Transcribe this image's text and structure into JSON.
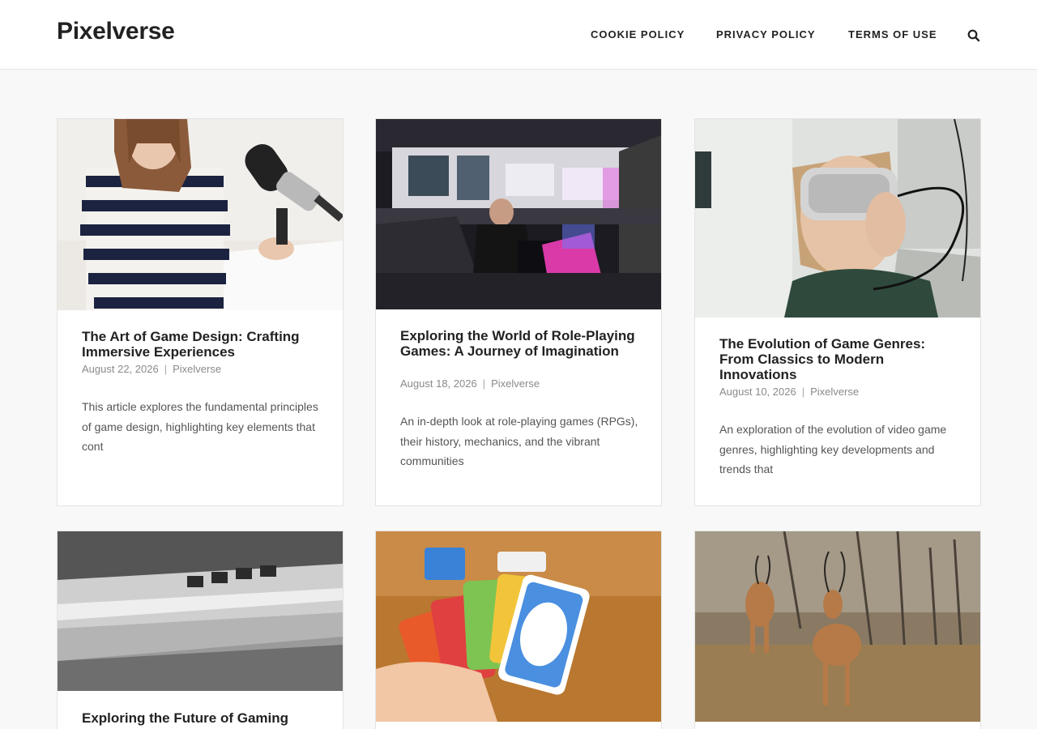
{
  "site": {
    "title": "Pixelverse"
  },
  "nav": {
    "items": [
      {
        "label": "COOKIE POLICY"
      },
      {
        "label": "PRIVACY POLICY"
      },
      {
        "label": "TERMS OF USE"
      }
    ],
    "search_icon": "search-icon"
  },
  "posts": [
    {
      "title": "The Art of Game Design: Crafting Immersive Experiences",
      "date": "August 22, 2026",
      "author": "Pixelverse",
      "excerpt": "This article explores the fundamental principles of game design, highlighting key elements that cont"
    },
    {
      "title": "Exploring the World of Role-Playing Games: A Journey of Imagination",
      "date": "August 18, 2026",
      "author": "Pixelverse",
      "excerpt": "An in-depth look at role-playing games (RPGs), their history, mechanics, and the vibrant communities"
    },
    {
      "title": "The Evolution of Game Genres: From Classics to Modern Innovations",
      "date": "August 10, 2026",
      "author": "Pixelverse",
      "excerpt": "An exploration of the evolution of video game genres, highlighting key developments and trends that"
    },
    {
      "title": "Exploring the Future of Gaming"
    },
    {
      "title": ""
    },
    {
      "title": ""
    }
  ],
  "meta": {
    "separator": "|"
  },
  "colors": {
    "background": "#f8f8f8",
    "card": "#ffffff",
    "text": "#222222",
    "meta": "#8a8a8a"
  }
}
